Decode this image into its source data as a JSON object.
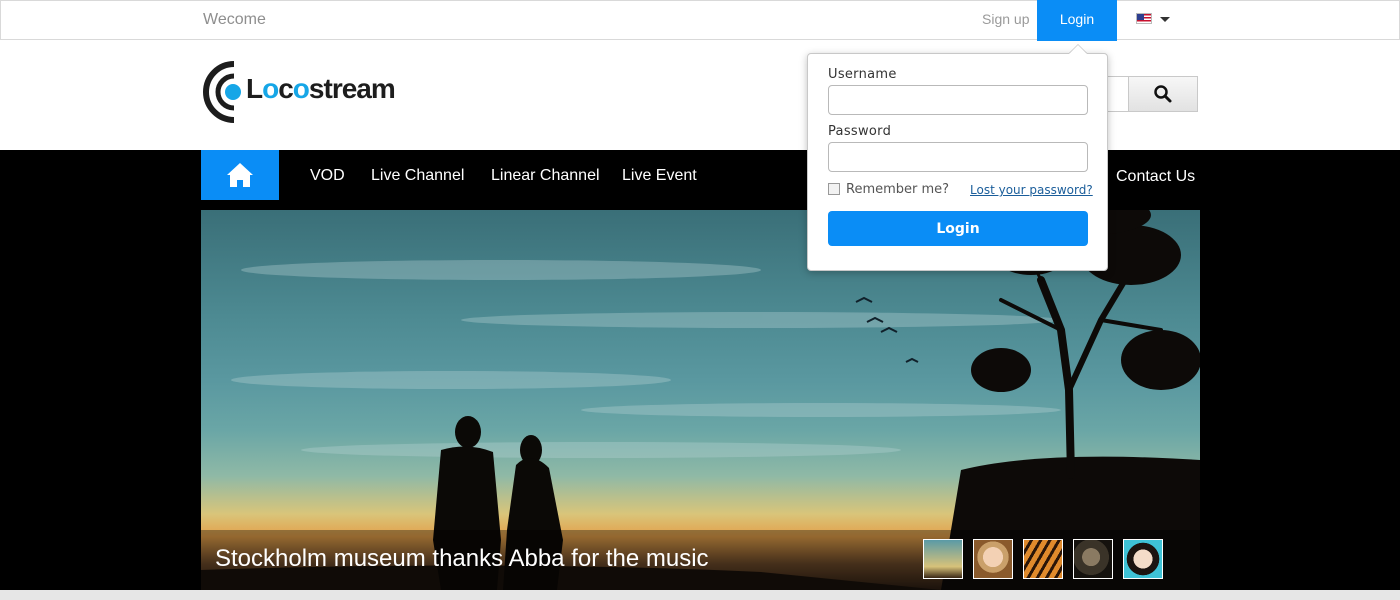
{
  "topbar": {
    "welcome": "Wecome",
    "signup": "Sign up",
    "login": "Login",
    "language_icon": "us-flag-icon"
  },
  "header": {
    "logo": "Locostream",
    "search_icon": "search-icon"
  },
  "nav": {
    "home_icon": "home-icon",
    "items": [
      "VOD",
      "Live Channel",
      "Linear Channel",
      "Live Event",
      "Contact Us"
    ]
  },
  "hero": {
    "caption": "Stockholm museum thanks Abba for the music",
    "thumbnails": [
      "couple-thumbnail",
      "woman-thumbnail",
      "tiger-thumbnail",
      "actor-thumbnail",
      "portrait-thumbnail"
    ]
  },
  "login_panel": {
    "username_label": "Username",
    "password_label": "Password",
    "remember_label": "Remember me?",
    "lost_password": "Lost your password?",
    "submit": "Login"
  },
  "colors": {
    "accent": "#0a8df6",
    "nav_bg": "#000000",
    "logo_accent": "#16a6e7"
  }
}
